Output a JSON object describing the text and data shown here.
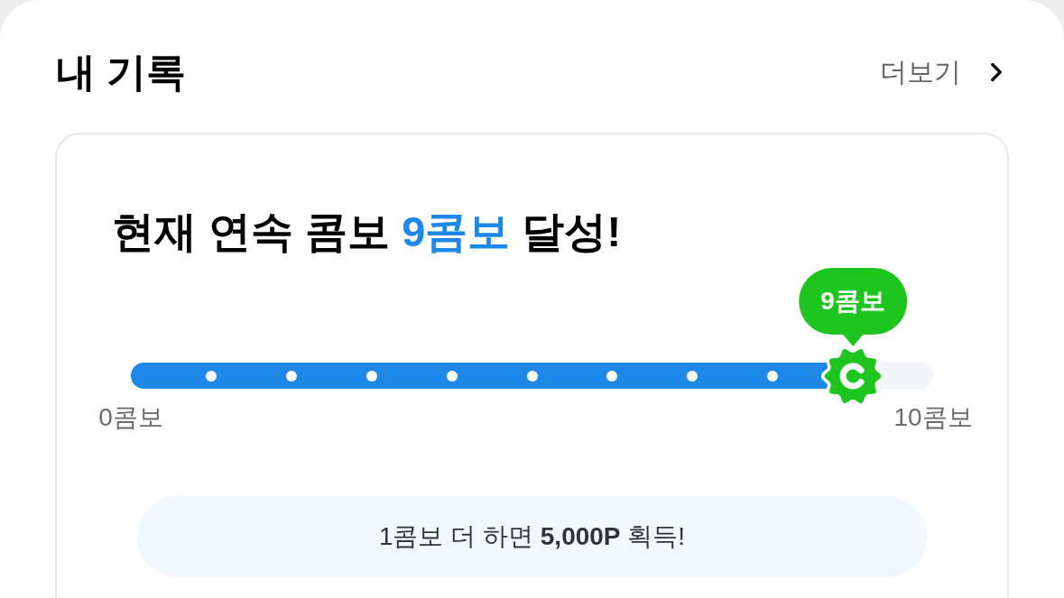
{
  "header": {
    "title": "내 기록",
    "more_link": "더보기"
  },
  "combo_card": {
    "headline": {
      "prefix": "현재 연속 콤보",
      "highlight": "9콤보",
      "suffix": "달성!"
    },
    "progress": {
      "level": 0.9,
      "bubble": "9콤보",
      "start_label": "0콤보",
      "end_label": "10콤보"
    },
    "reward": "1콤보 더 하면 **5,000P** 획득!"
  }
}
